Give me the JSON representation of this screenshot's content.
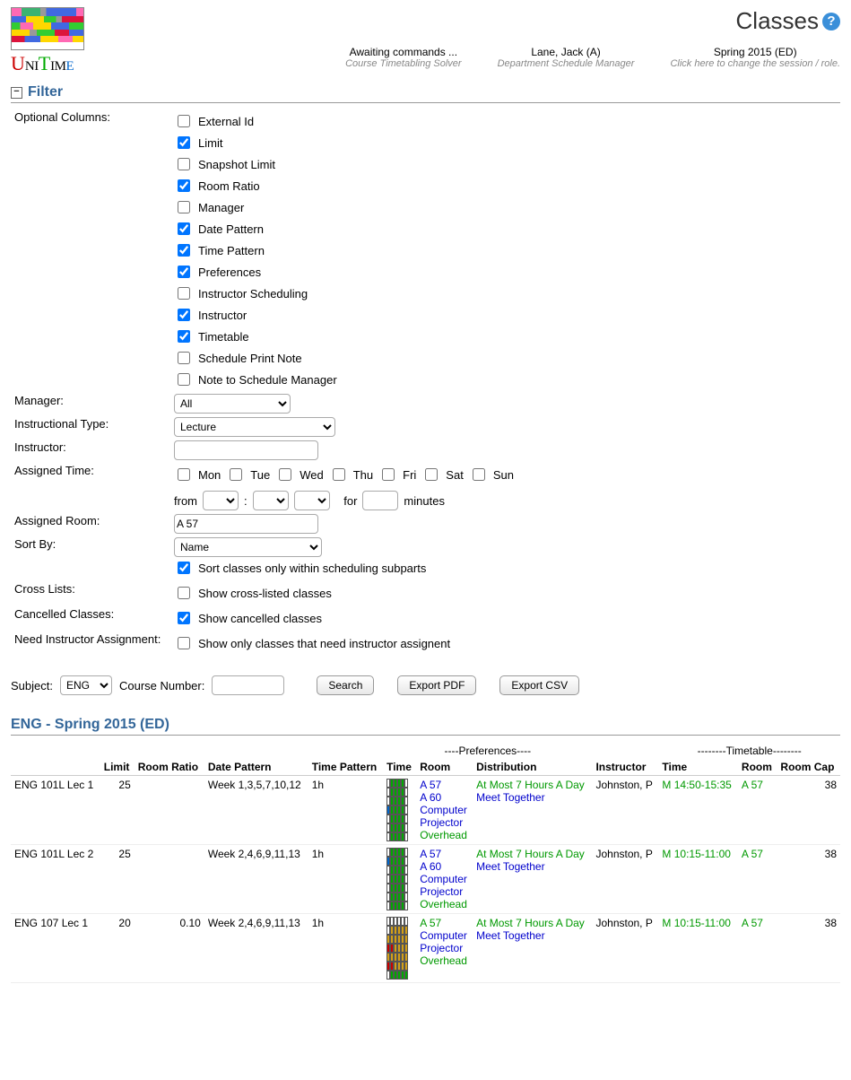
{
  "page_title": "Classes",
  "header_info": [
    {
      "main": "Awaiting commands ...",
      "sub": "Course Timetabling Solver"
    },
    {
      "main": "Lane, Jack (A)",
      "sub": "Department Schedule Manager"
    },
    {
      "main": "Spring 2015 (ED)",
      "sub": "Click here to change the session / role."
    }
  ],
  "filter": {
    "title": "Filter",
    "optional_label": "Optional Columns:",
    "columns": [
      {
        "label": "External Id",
        "checked": false
      },
      {
        "label": "Limit",
        "checked": true
      },
      {
        "label": "Snapshot Limit",
        "checked": false
      },
      {
        "label": "Room Ratio",
        "checked": true
      },
      {
        "label": "Manager",
        "checked": false
      },
      {
        "label": "Date Pattern",
        "checked": true
      },
      {
        "label": "Time Pattern",
        "checked": true
      },
      {
        "label": "Preferences",
        "checked": true
      },
      {
        "label": "Instructor Scheduling",
        "checked": false
      },
      {
        "label": "Instructor",
        "checked": true
      },
      {
        "label": "Timetable",
        "checked": true
      },
      {
        "label": "Schedule Print Note",
        "checked": false
      },
      {
        "label": "Note to Schedule Manager",
        "checked": false
      }
    ],
    "manager_label": "Manager:",
    "manager_value": "All",
    "itype_label": "Instructional Type:",
    "itype_value": "Lecture",
    "instructor_label": "Instructor:",
    "instructor_value": "",
    "assigned_time_label": "Assigned Time:",
    "days": [
      "Mon",
      "Tue",
      "Wed",
      "Thu",
      "Fri",
      "Sat",
      "Sun"
    ],
    "from_label": "from",
    "for_label": "for",
    "minutes_label": "minutes",
    "minutes_value": "",
    "assigned_room_label": "Assigned Room:",
    "assigned_room_value": "A 57",
    "sort_by_label": "Sort By:",
    "sort_by_value": "Name",
    "sort_within_label": "Sort classes only within scheduling subparts",
    "sort_within_checked": true,
    "cross_lists_label": "Cross Lists:",
    "cross_lists_text": "Show cross-listed classes",
    "cross_lists_checked": false,
    "cancelled_label": "Cancelled Classes:",
    "cancelled_text": "Show cancelled classes",
    "cancelled_checked": true,
    "need_instr_label": "Need Instructor Assignment:",
    "need_instr_text": "Show only classes that need instructor assignent",
    "need_instr_checked": false,
    "subject_label": "Subject:",
    "subject_value": "ENG",
    "course_number_label": "Course Number:",
    "course_number_value": "",
    "search_btn": "Search",
    "export_pdf_btn": "Export PDF",
    "export_csv_btn": "Export CSV"
  },
  "results": {
    "title": "ENG - Spring 2015 (ED)",
    "group_prefs": "----Preferences----",
    "group_timetable": "--------Timetable--------",
    "headers": {
      "class": "",
      "limit": "Limit",
      "room_ratio": "Room Ratio",
      "date_pattern": "Date Pattern",
      "time_pattern": "Time Pattern",
      "time": "Time",
      "room": "Room",
      "distribution": "Distribution",
      "instructor": "Instructor",
      "tt_time": "Time",
      "tt_room": "Room",
      "room_cap": "Room Cap"
    },
    "rows": [
      {
        "class": "ENG 101L Lec 1",
        "limit": "25",
        "room_ratio": "",
        "date_pattern": "Week 1,3,5,7,10,12",
        "time_pattern": "1h",
        "grid": "green",
        "rooms": [
          "A 57",
          "A 60",
          "Computer",
          "Projector",
          "Overhead"
        ],
        "dists": [
          {
            "text": "At Most 7 Hours A Day",
            "cls": "dist-pref"
          },
          {
            "text": "Meet Together",
            "cls": "dist-pref blue"
          }
        ],
        "instructor": "Johnston, P",
        "tt_time": "M 14:50-15:35",
        "tt_room": "A 57",
        "room_cap": "38"
      },
      {
        "class": "ENG 101L Lec 2",
        "limit": "25",
        "room_ratio": "",
        "date_pattern": "Week 2,4,6,9,11,13",
        "time_pattern": "1h",
        "grid": "green-blue",
        "rooms": [
          "A 57",
          "A 60",
          "Computer",
          "Projector",
          "Overhead"
        ],
        "dists": [
          {
            "text": "At Most 7 Hours A Day",
            "cls": "dist-pref"
          },
          {
            "text": "Meet Together",
            "cls": "dist-pref blue"
          }
        ],
        "instructor": "Johnston, P",
        "tt_time": "M 10:15-11:00",
        "tt_room": "A 57",
        "room_cap": "38"
      },
      {
        "class": "ENG 107 Lec 1",
        "limit": "20",
        "room_ratio": "0.10",
        "date_pattern": "Week 2,4,6,9,11,13",
        "time_pattern": "1h",
        "grid": "mixed",
        "rooms": [
          "A 57",
          "Computer",
          "Projector",
          "Overhead"
        ],
        "dists": [
          {
            "text": "At Most 7 Hours A Day",
            "cls": "dist-pref"
          },
          {
            "text": "Meet Together",
            "cls": "dist-pref blue"
          }
        ],
        "instructor": "Johnston, P",
        "tt_time": "M 10:15-11:00",
        "tt_room": "A 57",
        "room_cap": "38"
      }
    ]
  }
}
